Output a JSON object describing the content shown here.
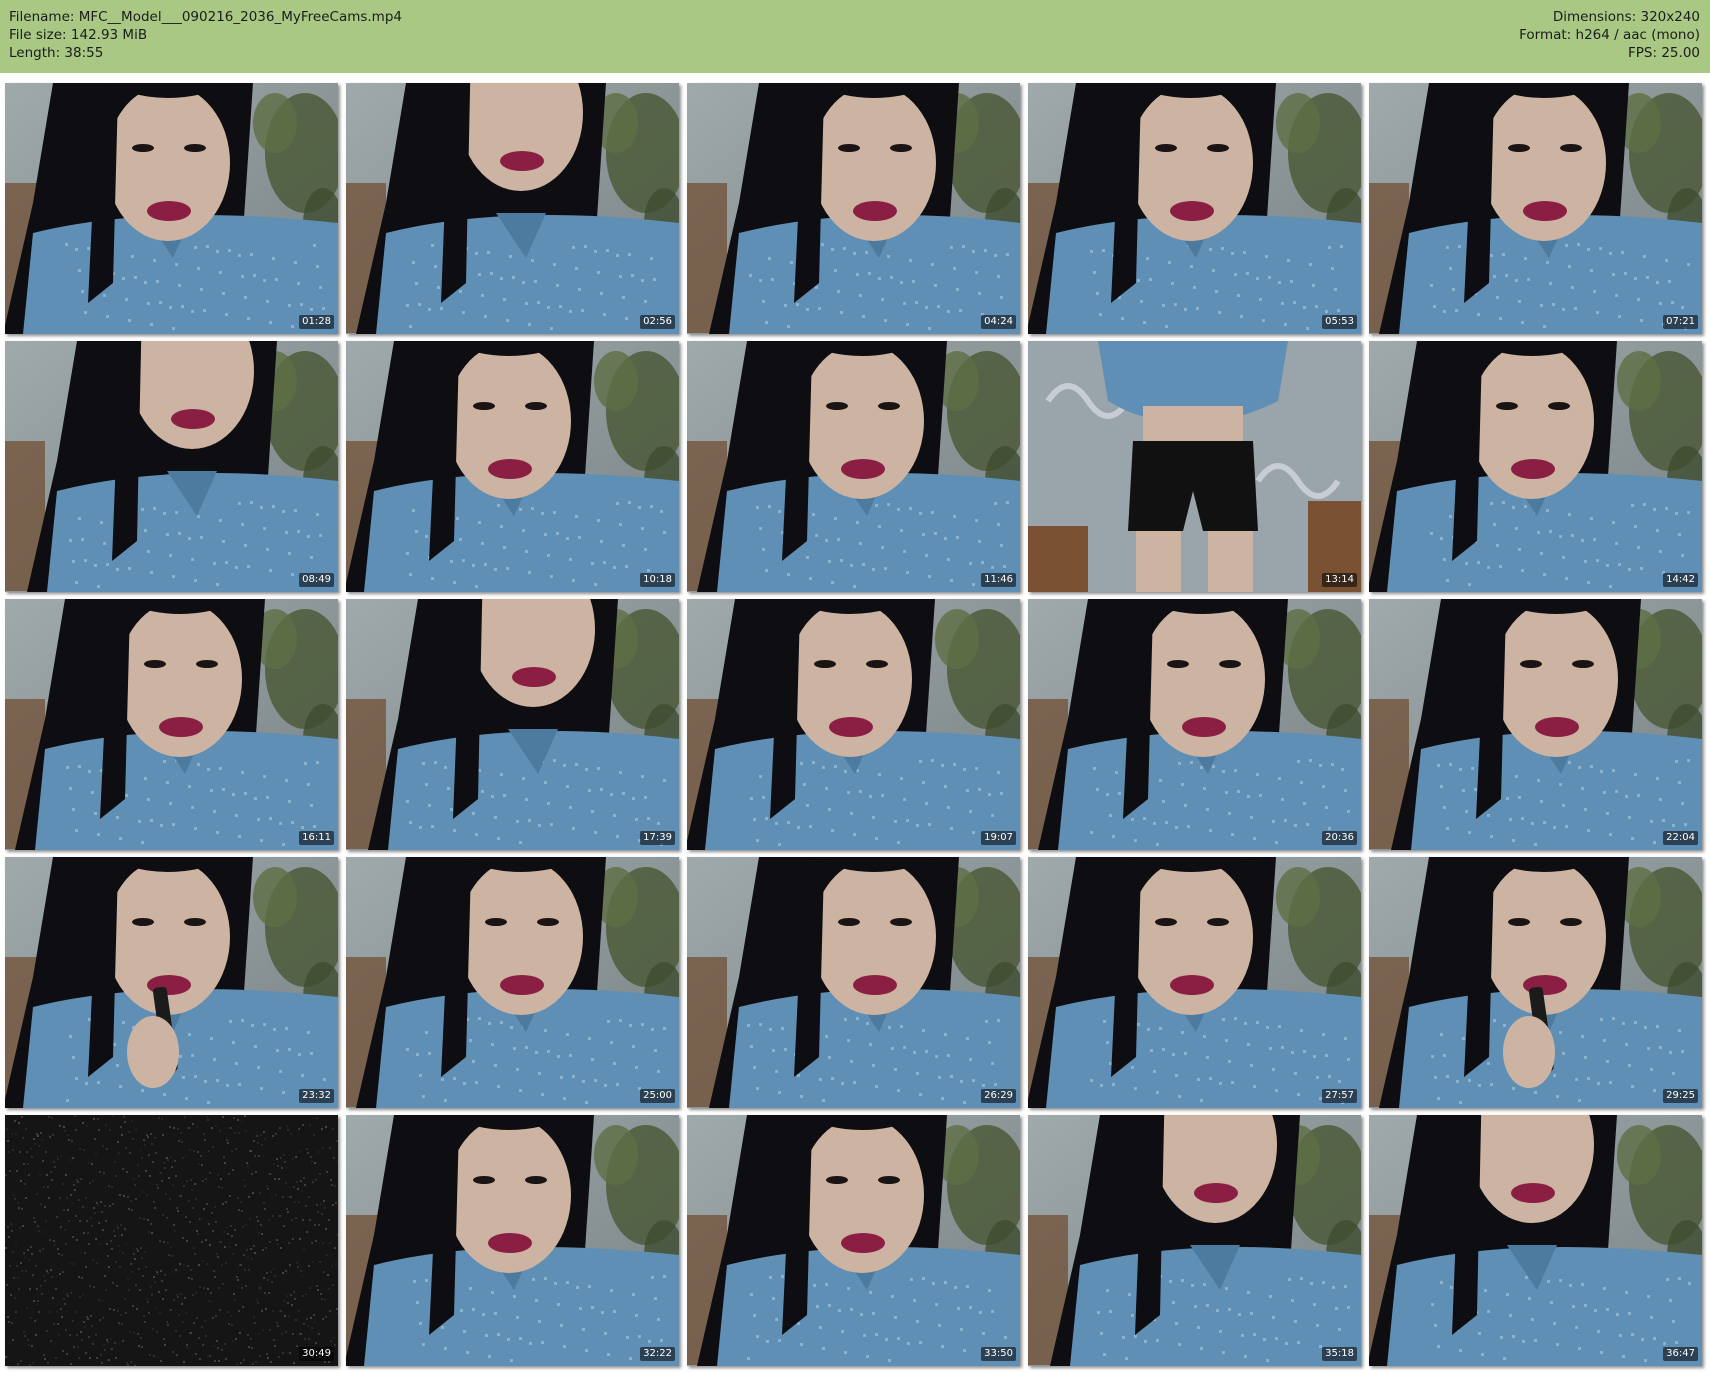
{
  "header": {
    "filename": "Filename: MFC__Model___090216_2036_MyFreeCams.mp4",
    "filesize": "File size: 142.93 MiB",
    "length": "Length: 38:55",
    "dimensions": "Dimensions: 320x240",
    "format": "Format: h264 / aac (mono)",
    "fps": "FPS: 25.00"
  },
  "colors": {
    "header_bg": "#a9c884",
    "shirt": "#5f8fb5",
    "hair": "#0d0d12",
    "lips": "#8a1f43",
    "skin": "#cdb4a2",
    "wall": "#8f9a9c",
    "plant": "#4c5a3a",
    "noise_frame": "#151515"
  },
  "thumbnails": [
    {
      "time": "01:28",
      "scene": "face-close",
      "icon": "video-frame-image"
    },
    {
      "time": "02:56",
      "scene": "lips-close",
      "icon": "video-frame-image"
    },
    {
      "time": "04:24",
      "scene": "face-close",
      "icon": "video-frame-image"
    },
    {
      "time": "05:53",
      "scene": "face-close",
      "icon": "video-frame-image"
    },
    {
      "time": "07:21",
      "scene": "face-close",
      "icon": "video-frame-image"
    },
    {
      "time": "08:49",
      "scene": "lips-close",
      "icon": "video-frame-image"
    },
    {
      "time": "10:18",
      "scene": "face-close",
      "icon": "video-frame-image"
    },
    {
      "time": "11:46",
      "scene": "face-close",
      "icon": "video-frame-image"
    },
    {
      "time": "13:14",
      "scene": "standing",
      "icon": "video-frame-image"
    },
    {
      "time": "14:42",
      "scene": "face-close",
      "icon": "video-frame-image"
    },
    {
      "time": "16:11",
      "scene": "face-close",
      "icon": "video-frame-image"
    },
    {
      "time": "17:39",
      "scene": "lips-close",
      "icon": "video-frame-image"
    },
    {
      "time": "19:07",
      "scene": "face-close",
      "icon": "video-frame-image"
    },
    {
      "time": "20:36",
      "scene": "face-close",
      "icon": "video-frame-image"
    },
    {
      "time": "22:04",
      "scene": "face-close",
      "icon": "video-frame-image"
    },
    {
      "time": "23:32",
      "scene": "lipstick",
      "icon": "video-frame-image"
    },
    {
      "time": "25:00",
      "scene": "face-close",
      "icon": "video-frame-image"
    },
    {
      "time": "26:29",
      "scene": "face-close",
      "icon": "video-frame-image"
    },
    {
      "time": "27:57",
      "scene": "face-close",
      "icon": "video-frame-image"
    },
    {
      "time": "29:25",
      "scene": "lipstick",
      "icon": "video-frame-image"
    },
    {
      "time": "30:49",
      "scene": "noise",
      "icon": "video-frame-image"
    },
    {
      "time": "32:22",
      "scene": "face-close",
      "icon": "video-frame-image"
    },
    {
      "time": "33:50",
      "scene": "face-close",
      "icon": "video-frame-image"
    },
    {
      "time": "35:18",
      "scene": "lips-close",
      "icon": "video-frame-image"
    },
    {
      "time": "36:47",
      "scene": "lips-close",
      "icon": "video-frame-image"
    }
  ]
}
